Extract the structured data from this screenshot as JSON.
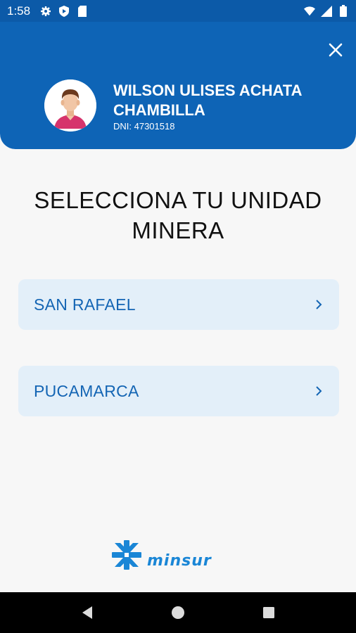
{
  "status_bar": {
    "time": "1:58",
    "icons_left": [
      "gear-icon",
      "shield-icon",
      "sim-card-icon"
    ],
    "icons_right": [
      "wifi-icon",
      "signal-icon",
      "battery-icon"
    ]
  },
  "header": {
    "user_name": "WILSON ULISES ACHATA CHAMBILLA",
    "dni": "DNI: 47301518",
    "background_color": "#0e64b6"
  },
  "main": {
    "title": "SELECCIONA TU UNIDAD MINERA",
    "options": [
      {
        "label": "SAN RAFAEL"
      },
      {
        "label": "PUCAMARCA"
      }
    ]
  },
  "footer": {
    "logo_text": "minsur",
    "logo_color": "#1a86d6"
  },
  "nav_bar": {
    "buttons": [
      "back-icon",
      "home-icon",
      "recents-icon"
    ]
  }
}
